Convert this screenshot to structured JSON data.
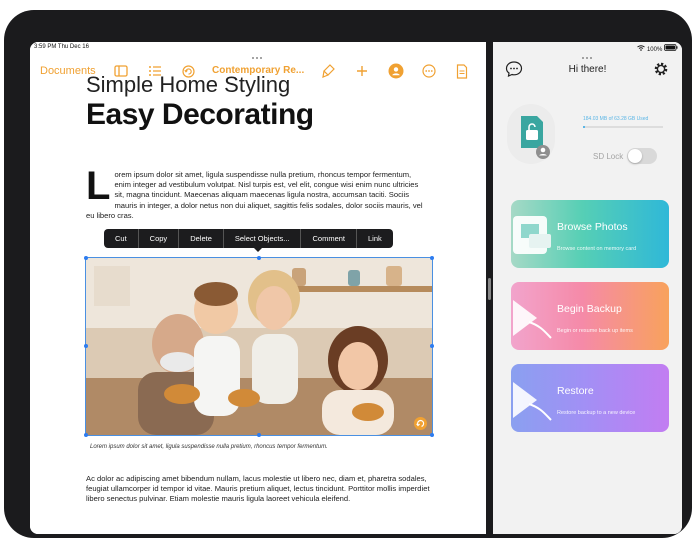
{
  "status_bar": {
    "time_date": "3:59 PM  Thu Dec 16",
    "battery": "100%"
  },
  "toolbar": {
    "documents_label": "Documents",
    "doc_title": "Contemporary Re..."
  },
  "document": {
    "subtitle": "Simple Home Styling",
    "title": "Easy Decorating",
    "dropcap": "L",
    "paragraph1": "orem ipsum dolor sit amet, ligula suspendisse nulla pretium, rhoncus tempor fermentum, enim integer ad vestibulum volutpat. Nisl turpis est, vel elit, congue wisi enim nunc ultricies sit, magna tincidunt. Maecenas aliquam maecenas ligula nostra, accumsan taciti. Sociis mauris in integer, a dolor netus non dui aliquet, sagittis felis sodales, dolor sociis mauris, vel eu libero cras.",
    "caption": "Lorem ipsum dolor sit amet, ligula suspendisse nulla pretium, rhoncus tempor fermentum.",
    "paragraph2": "Ac dolor ac adipiscing amet bibendum nullam, lacus molestie ut libero nec, diam et, pharetra sodales, feugiat ullamcorper id tempor id vitae. Mauris pretium aliquet, lectus tincidunt. Porttitor mollis imperdiet libero senectus pulvinar. Etiam molestie mauris ligula laoreet vehicula eleifend."
  },
  "context_menu": [
    "Cut",
    "Copy",
    "Delete",
    "Select Objects...",
    "Comment",
    "Link"
  ],
  "right_panel": {
    "header_title": "Hi there!",
    "storage_text": "184.03 MB of 63.28 GB Used",
    "storage_used_fraction": 0.003,
    "sd_lock_label": "SD Lock",
    "sd_lock_on": false,
    "actions": [
      {
        "label": "Browse Photos",
        "desc": "Browse content on memory card"
      },
      {
        "label": "Begin Backup",
        "desc": "Begin or resume back up items"
      },
      {
        "label": "Restore",
        "desc": "Restore backup to a new device"
      }
    ]
  },
  "colors": {
    "accent": "#f0a132",
    "selection": "#2d7cf0",
    "browse": "#2fb8d8",
    "backup": "#f58aa8",
    "restore": "#a190f5"
  }
}
